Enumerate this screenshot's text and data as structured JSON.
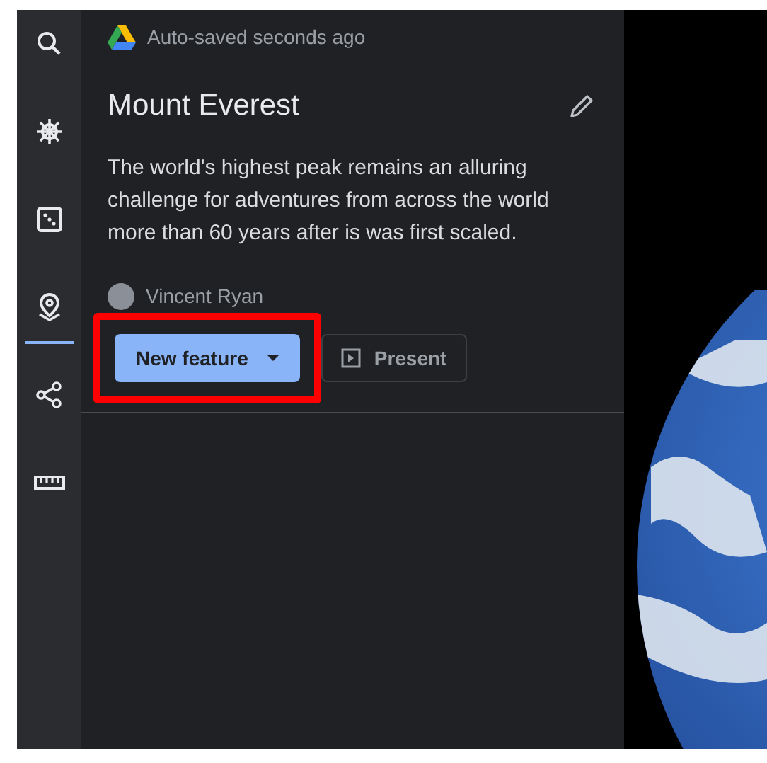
{
  "rail": [
    {
      "kind": "search",
      "selected": false
    },
    {
      "kind": "helm",
      "selected": false
    },
    {
      "kind": "dice",
      "selected": false
    },
    {
      "kind": "pin",
      "selected": true
    },
    {
      "kind": "share",
      "selected": false
    },
    {
      "kind": "ruler",
      "selected": false
    }
  ],
  "panel": {
    "save_status": "Auto-saved seconds ago",
    "title": "Mount Everest",
    "description": "The world's highest peak remains an alluring challenge for adventures from across the world more than 60 years after is was first scaled.",
    "author": "Vincent Ryan",
    "buttons": [
      {
        "kind": "primary",
        "label": "New feature",
        "highlighted": true
      },
      {
        "kind": "present",
        "label": "Present",
        "highlighted": false
      }
    ]
  }
}
